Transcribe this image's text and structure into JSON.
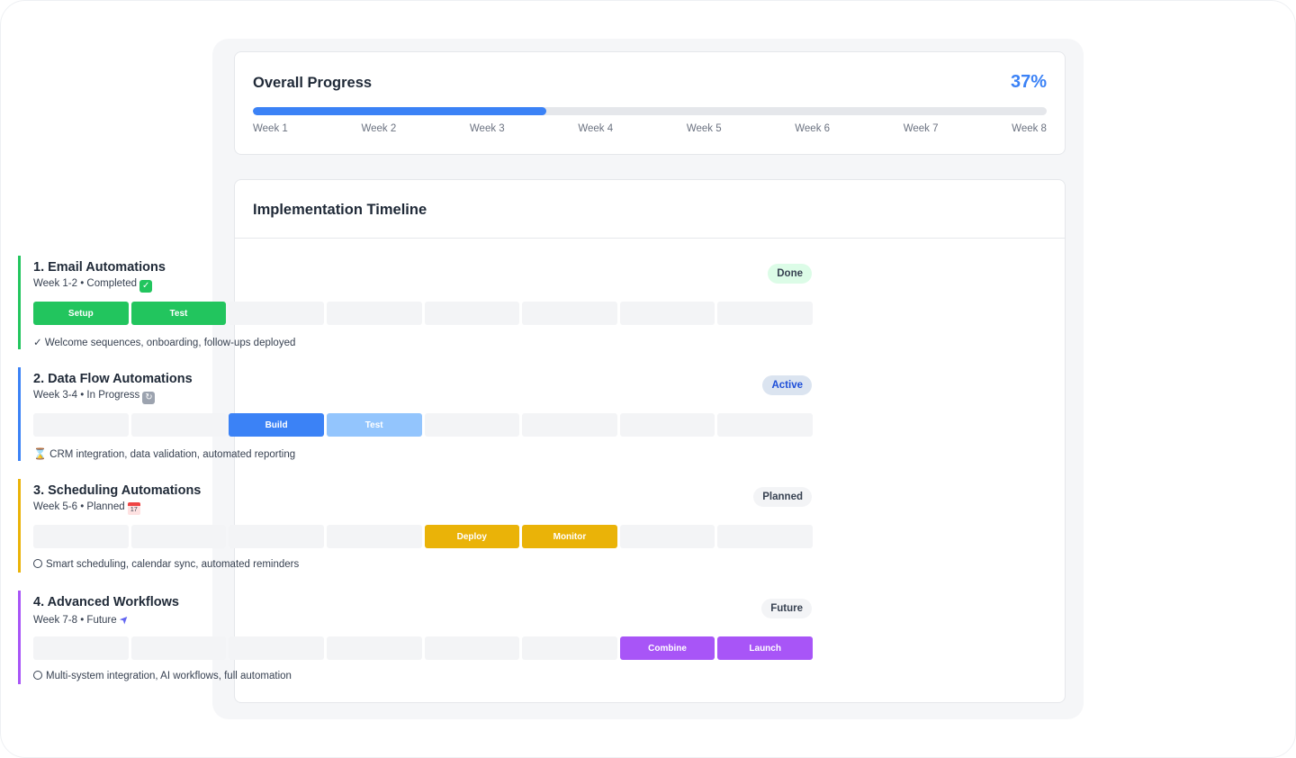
{
  "progress": {
    "title": "Overall Progress",
    "percent_label": "37%",
    "fraction": 0.37,
    "fill_color": "#3b82f6",
    "weeks": [
      "Week 1",
      "Week 2",
      "Week 3",
      "Week 4",
      "Week 5",
      "Week 6",
      "Week 7",
      "Week 8"
    ]
  },
  "timeline": {
    "title": "Implementation Timeline",
    "phases": [
      {
        "title": "1. Email Automations",
        "subtitle": "Week 1-2 • Completed",
        "subtitle_icon": "check-box-icon",
        "badge": "Done",
        "accent": "#22c55e",
        "cells": [
          "Setup",
          "Test",
          "",
          "",
          "",
          "",
          "",
          ""
        ],
        "note_icon": "✓",
        "note": "Welcome sequences, onboarding, follow-ups deployed"
      },
      {
        "title": "2. Data Flow Automations",
        "subtitle": "Week 3-4 • In Progress",
        "subtitle_icon": "cycle-icon",
        "badge": "Active",
        "accent": "#3b82f6",
        "cells": [
          "",
          "",
          "Build",
          "Test",
          "",
          "",
          "",
          ""
        ],
        "note_icon": "hourglass-icon",
        "note": "CRM integration, data validation, automated reporting"
      },
      {
        "title": "3. Scheduling Automations",
        "subtitle": "Week 5-6 • Planned",
        "subtitle_icon": "calendar-icon",
        "badge": "Planned",
        "accent": "#eab308",
        "cells": [
          "",
          "",
          "",
          "",
          "Deploy",
          "Monitor",
          "",
          ""
        ],
        "note_icon": "circle-icon",
        "note": "Smart scheduling, calendar sync, automated reminders"
      },
      {
        "title": "4. Advanced Workflows",
        "subtitle": "Week 7-8 • Future",
        "subtitle_icon": "rocket-icon",
        "badge": "Future",
        "accent": "#a855f7",
        "cells": [
          "",
          "",
          "",
          "",
          "",
          "",
          "Combine",
          "Launch"
        ],
        "note_icon": "circle-icon",
        "note": "Multi-system integration, AI workflows, full automation"
      }
    ]
  }
}
